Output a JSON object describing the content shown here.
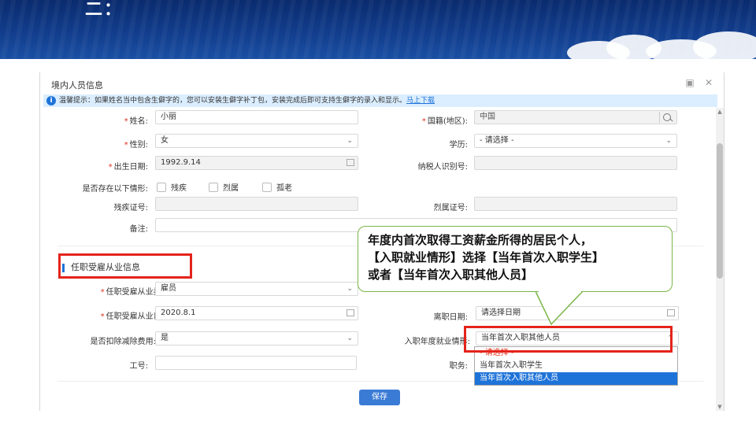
{
  "banner": {
    "title": "二："
  },
  "dialog": {
    "title": "境内人员信息",
    "notice": {
      "icon": "info-icon",
      "text": "温馨提示：如果姓名当中包含生僻字的，您可以安装生僻字补丁包，安装完成后即可支持生僻字的录入和显示。",
      "link": "马上下载"
    }
  },
  "basic": {
    "name": {
      "label": "姓名:",
      "value": "小丽"
    },
    "nationality": {
      "label": "国籍(地区):",
      "value": "中国"
    },
    "gender": {
      "label": "性别:",
      "value": "女"
    },
    "education": {
      "label": "学历:",
      "value": "- 请选择 -"
    },
    "birthdate": {
      "label": "出生日期:",
      "value": "1992.9.14"
    },
    "taxid": {
      "label": "纳税人识别号:",
      "value": ""
    },
    "conditions": {
      "label": "是否存在以下情形:",
      "options": [
        "残疾",
        "烈属",
        "孤老"
      ]
    },
    "disability_no": {
      "label": "残疾证号:",
      "value": ""
    },
    "martyr_no": {
      "label": "烈属证号:",
      "value": ""
    },
    "remark": {
      "label": "备注:",
      "value": ""
    }
  },
  "employment": {
    "section_title": "任职受雇从业信息",
    "type": {
      "label": "任职受雇从业类型:",
      "value": "雇员"
    },
    "date": {
      "label": "任职受雇从业日期:",
      "value": "2020.8.1"
    },
    "leave_date": {
      "label": "离职日期:",
      "placeholder": "请选择日期"
    },
    "deduct": {
      "label": "是否扣除减除费用:",
      "value": "是"
    },
    "first_job": {
      "label": "入职年度就业情形:",
      "value": "当年首次入职其他人员"
    },
    "job_no": {
      "label": "工号:",
      "value": ""
    },
    "position": {
      "label": "职务:",
      "value": ""
    }
  },
  "dropdown": {
    "options": [
      "- 请选择 -",
      "当年首次入职学生",
      "当年首次入职其他人员"
    ],
    "selected_index": 2
  },
  "callout": {
    "line1": "年度内首次取得工资薪金所得的居民个人，",
    "line2": "【入职就业情形】选择【当年首次入职学生】",
    "line3": "或者【当年首次入职其他人员】"
  },
  "save_button": "保存",
  "colors": {
    "accent": "#1e73d8",
    "highlight": "#e4241b",
    "callout_border": "#7ab648"
  }
}
